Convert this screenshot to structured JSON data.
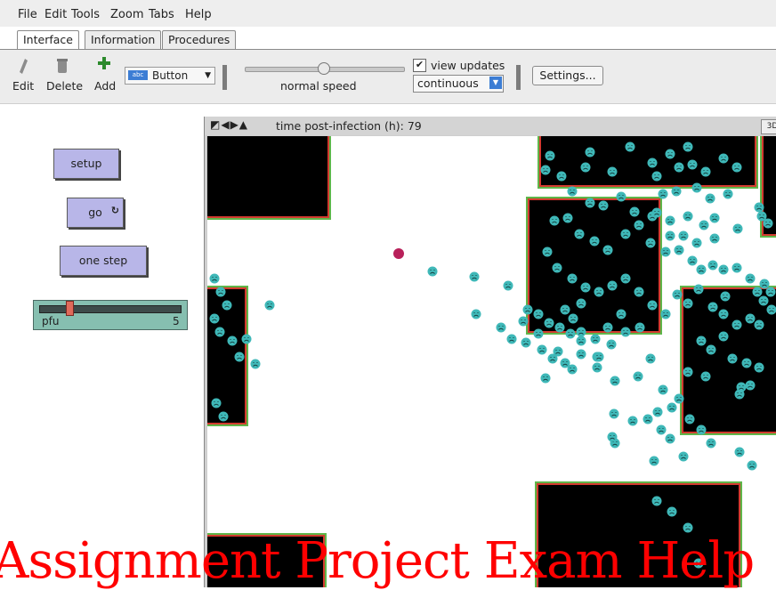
{
  "menu": [
    "File",
    "Edit",
    "Tools",
    "Zoom",
    "Tabs",
    "Help"
  ],
  "tabs": [
    {
      "label": "Interface",
      "active": true
    },
    {
      "label": "Information",
      "active": false
    },
    {
      "label": "Procedures",
      "active": false
    }
  ],
  "toolbar": {
    "edit_label": "Edit",
    "delete_label": "Delete",
    "add_label": "Add",
    "widget_type": "Button",
    "widget_icon_text": "abc",
    "speed_label": "normal speed",
    "view_updates_label": "view updates",
    "view_updates_checked": true,
    "update_mode": "continuous",
    "settings_label": "Settings..."
  },
  "interface": {
    "buttons": {
      "setup": "setup",
      "go": "go",
      "one_step": "one step"
    },
    "slider": {
      "label": "pfu",
      "value": "5",
      "fraction": 0.24
    }
  },
  "view": {
    "title": "time post-infection (h): 79",
    "three_d_label": "3D",
    "colors": {
      "cell_black": "#000000",
      "infected_red": "#d33a2f",
      "border_green": "#5fb64a",
      "virus_cyan": "#3fb8b8",
      "source_magenta": "#b8205a"
    }
  },
  "watermark": "Assignment Project Exam Help"
}
